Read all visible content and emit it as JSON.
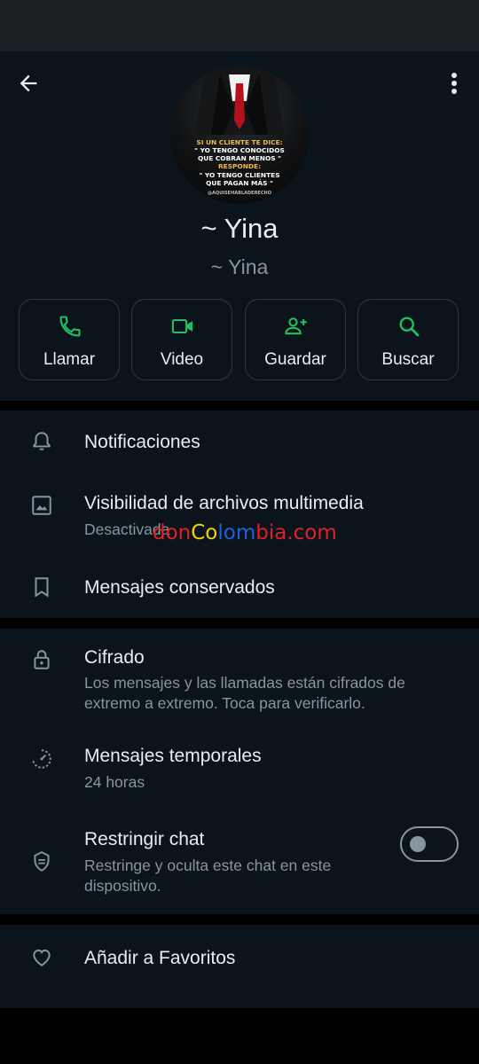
{
  "contact": {
    "name": "~ Yina",
    "subname": "~ Yina",
    "avatar_text": {
      "line1": "SI UN CLIENTE TE DICE:",
      "line2": "\" YO TENGO CONOCIDOS",
      "line3": "QUE COBRAN MENOS \"",
      "line4": "RESPONDE:",
      "line5": "\" YO TENGO CLIENTES",
      "line6": "QUE PAGAN MÁS \"",
      "line7": "@AQUISEHABLADERECHO"
    }
  },
  "actions": [
    {
      "label": "Llamar",
      "icon": "phone-icon"
    },
    {
      "label": "Video",
      "icon": "video-icon"
    },
    {
      "label": "Guardar",
      "icon": "add-contact-icon"
    },
    {
      "label": "Buscar",
      "icon": "search-icon"
    }
  ],
  "settings1": {
    "notifications": {
      "title": "Notificaciones"
    },
    "media": {
      "title": "Visibilidad de archivos multimedia",
      "subtitle": "Desactivada"
    },
    "kept": {
      "title": "Mensajes conservados"
    }
  },
  "watermark": {
    "part1": "don",
    "part2": "Co",
    "part3": "lom",
    "part4": "bia.com"
  },
  "settings2": {
    "encryption": {
      "title": "Cifrado",
      "subtitle": "Los mensajes y las llamadas están cifrados de extremo a extremo. Toca para verificarlo."
    },
    "disappearing": {
      "title": "Mensajes temporales",
      "subtitle": "24 horas"
    },
    "restrict": {
      "title": "Restringir chat",
      "subtitle": "Restringe y oculta este chat en este dispositivo.",
      "enabled": false
    }
  },
  "settings3": {
    "favorites": {
      "title": "Añadir a Favoritos"
    }
  },
  "colors": {
    "accent": "#21c063",
    "background": "#0b141a",
    "muted": "#8696a0"
  }
}
